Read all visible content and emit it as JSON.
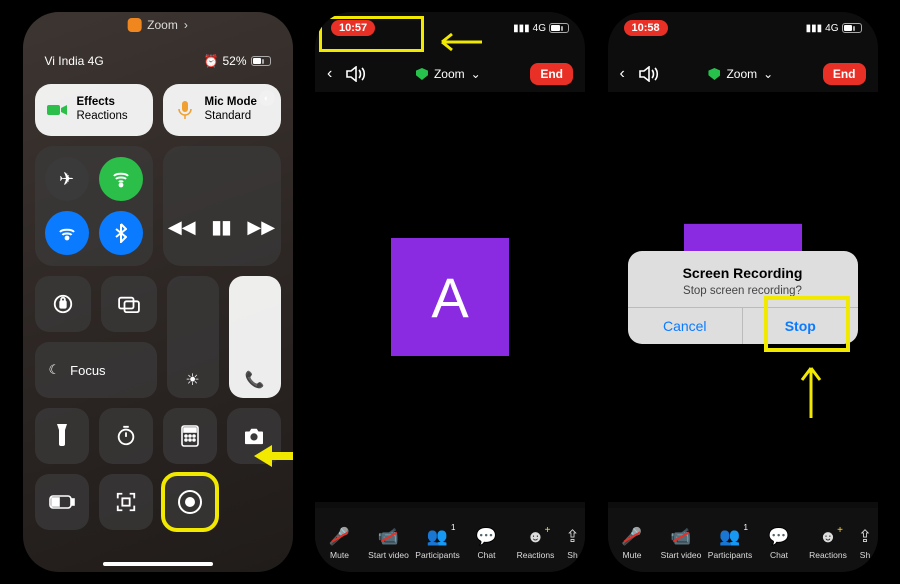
{
  "phone1": {
    "app_switch_label": "Zoom",
    "status_carrier": "Vi India 4G",
    "status_battery": "52%",
    "tiles": {
      "effects_line1": "Effects",
      "effects_line2": "Reactions",
      "micmode_line1": "Mic Mode",
      "micmode_line2": "Standard"
    },
    "focus_label": "Focus"
  },
  "phone2": {
    "time": "10:57",
    "network": "4G",
    "battery": "53",
    "zoom_label": "Zoom",
    "end_label": "End",
    "avatar_letter": "A",
    "bottom": {
      "mute": "Mute",
      "start_video": "Start video",
      "participants": "Participants",
      "participants_count": "1",
      "chat": "Chat",
      "reactions": "Reactions",
      "share": "Sh"
    }
  },
  "phone3": {
    "time": "10:58",
    "network": "4G",
    "battery": "53",
    "zoom_label": "Zoom",
    "end_label": "End",
    "alert_title": "Screen Recording",
    "alert_msg": "Stop screen recording?",
    "cancel": "Cancel",
    "stop": "Stop",
    "bottom": {
      "mute": "Mute",
      "start_video": "Start video",
      "participants": "Participants",
      "participants_count": "1",
      "chat": "Chat",
      "reactions": "Reactions",
      "share": "Sh"
    }
  }
}
